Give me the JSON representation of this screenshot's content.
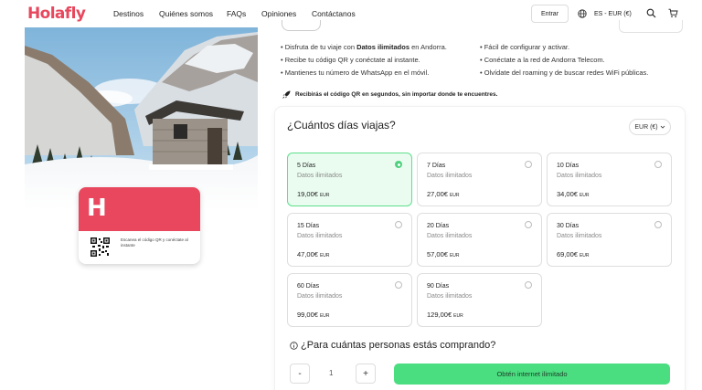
{
  "header": {
    "logo": "Holafly",
    "nav": [
      "Destinos",
      "Quiénes somos",
      "FAQs",
      "Opiniones",
      "Contáctanos"
    ],
    "login_label": "Entrar",
    "language_currency": "ES - EUR (€)",
    "icons": [
      "globe-icon",
      "search-icon",
      "cart-icon"
    ]
  },
  "esim_card": {
    "logo_letter": "H",
    "caption": "Escanea el código QR y conéctate al instante"
  },
  "features": {
    "left": [
      {
        "pre": "Disfruta de tu viaje con ",
        "bold": "Datos ilimitados",
        "post": " en Andorra."
      },
      {
        "pre": "Recibe tu código QR y conéctate al instante.",
        "bold": "",
        "post": ""
      },
      {
        "pre": "Mantienes tu número de WhatsApp en el móvil.",
        "bold": "",
        "post": ""
      }
    ],
    "right": [
      "Fácil de configurar y activar.",
      "Conéctate a la red de Andorra Telecom.",
      "Olvídate del roaming y de buscar redes WiFi públicas."
    ],
    "qr_note": "Recibirás el código QR en segundos, sin importar donde te encuentres."
  },
  "plans_section": {
    "title": "¿Cuántos días viajas?",
    "currency_label": "EUR (€)",
    "plans": [
      {
        "days": "5 Días",
        "data": "Datos ilimitados",
        "price": "19,00€",
        "currency": "EUR",
        "selected": true
      },
      {
        "days": "7 Días",
        "data": "Datos ilimitados",
        "price": "27,00€",
        "currency": "EUR",
        "selected": false
      },
      {
        "days": "10 Días",
        "data": "Datos ilimitados",
        "price": "34,00€",
        "currency": "EUR",
        "selected": false
      },
      {
        "days": "15 Días",
        "data": "Datos ilimitados",
        "price": "47,00€",
        "currency": "EUR",
        "selected": false
      },
      {
        "days": "20 Días",
        "data": "Datos ilimitados",
        "price": "57,00€",
        "currency": "EUR",
        "selected": false
      },
      {
        "days": "30 Días",
        "data": "Datos ilimitados",
        "price": "69,00€",
        "currency": "EUR",
        "selected": false
      },
      {
        "days": "60 Días",
        "data": "Datos ilimitados",
        "price": "99,00€",
        "currency": "EUR",
        "selected": false
      },
      {
        "days": "90 Días",
        "data": "Datos ilimitados",
        "price": "129,00€",
        "currency": "EUR",
        "selected": false
      }
    ]
  },
  "purchase": {
    "question": "¿Para cuántas personas estás comprando?",
    "minus": "-",
    "quantity": "1",
    "plus": "+",
    "cta": "Obtén internet ilimitado"
  },
  "colors": {
    "brand": "#e8475d",
    "accent_green": "#4ade80",
    "selected_bg": "#eafcf0"
  }
}
